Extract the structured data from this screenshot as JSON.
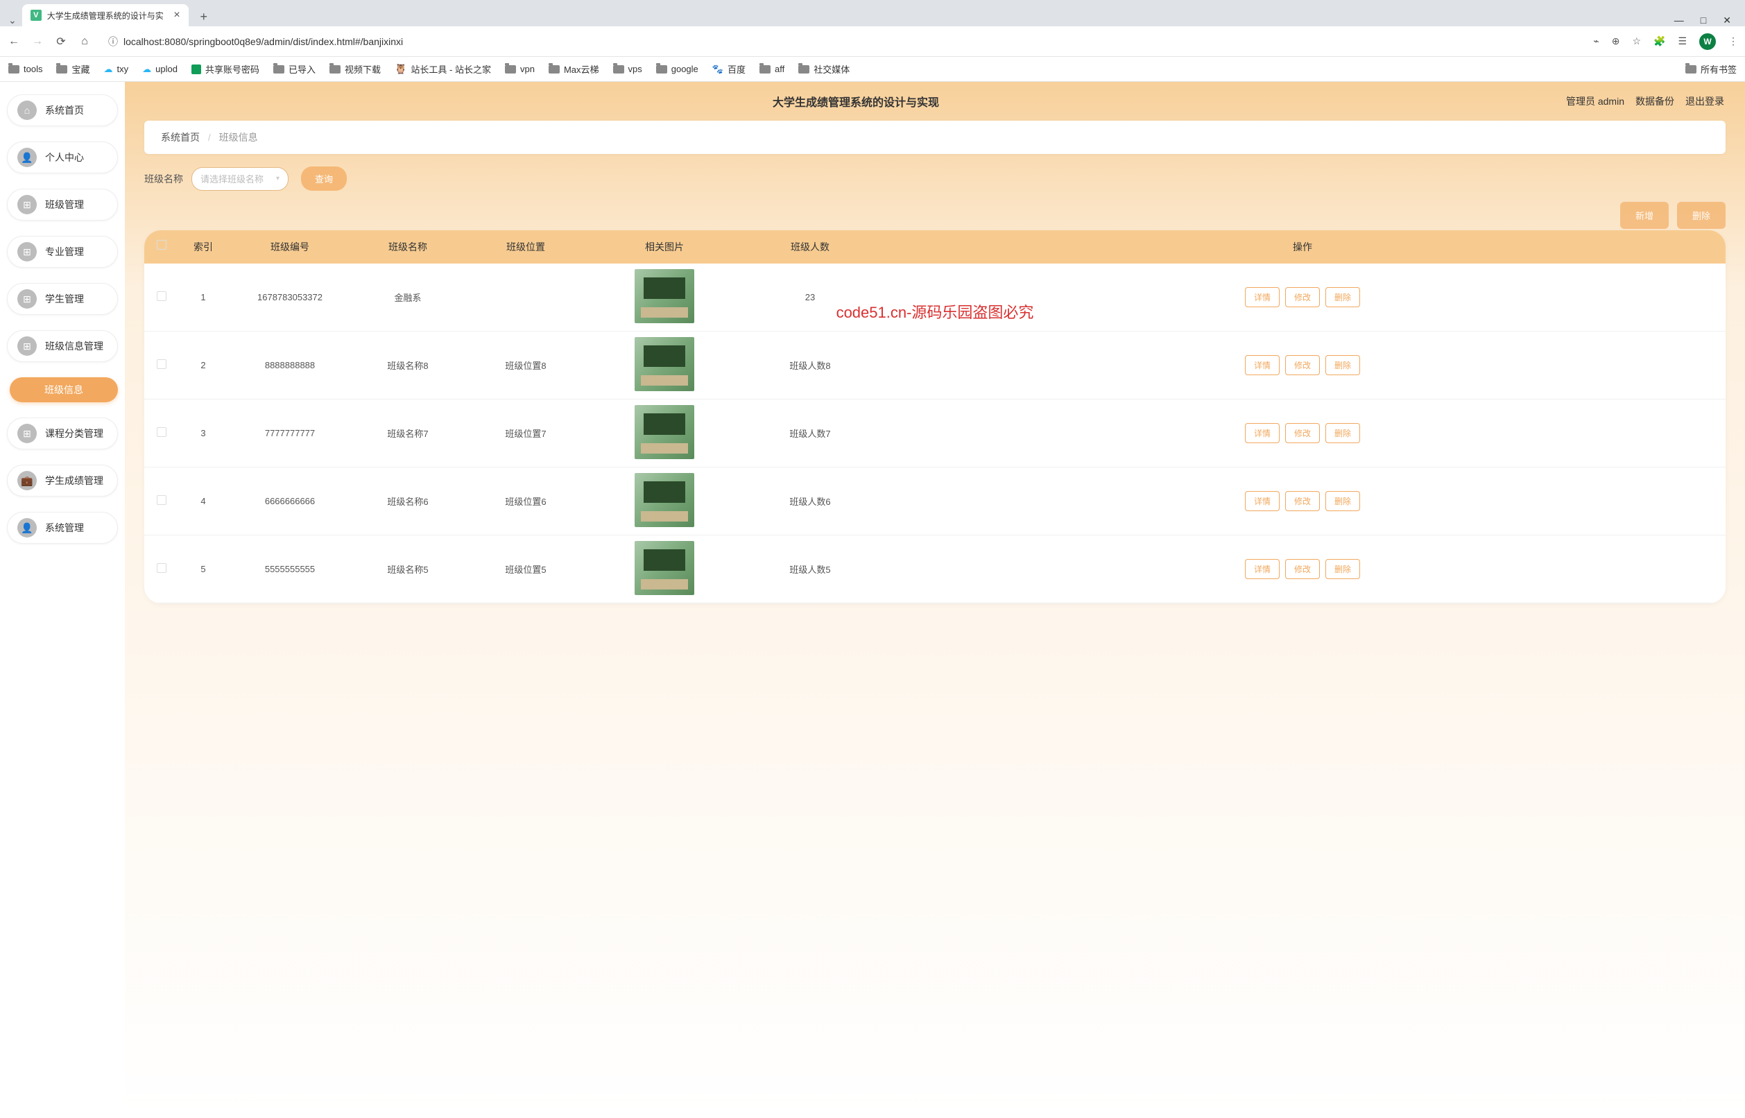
{
  "browser": {
    "tab_title": "大学生成绩管理系统的设计与实",
    "url": "localhost:8080/springboot0q8e9/admin/dist/index.html#/banjixinxi",
    "avatar_letter": "W",
    "favicon_letter": "V",
    "bookmarks": [
      {
        "label": "tools",
        "kind": "folder"
      },
      {
        "label": "宝藏",
        "kind": "folder"
      },
      {
        "label": "txy",
        "kind": "cloud"
      },
      {
        "label": "uplod",
        "kind": "cloud"
      },
      {
        "label": "共享账号密码",
        "kind": "sheet"
      },
      {
        "label": "已导入",
        "kind": "folder"
      },
      {
        "label": "视频下载",
        "kind": "folder"
      },
      {
        "label": "站长工具 - 站长之家",
        "kind": "owl"
      },
      {
        "label": "vpn",
        "kind": "folder"
      },
      {
        "label": "Max云梯",
        "kind": "folder"
      },
      {
        "label": "vps",
        "kind": "folder"
      },
      {
        "label": "google",
        "kind": "folder"
      },
      {
        "label": "百度",
        "kind": "paw"
      },
      {
        "label": "aff",
        "kind": "folder"
      },
      {
        "label": "社交媒体",
        "kind": "folder"
      }
    ],
    "bookmarks_right": {
      "label": "所有书签",
      "kind": "folder"
    }
  },
  "header": {
    "title": "大学生成绩管理系统的设计与实现",
    "user": "管理员 admin",
    "backup": "数据备份",
    "logout": "退出登录"
  },
  "sidebar": {
    "items": [
      {
        "label": "系统首页",
        "icon": "home"
      },
      {
        "label": "个人中心",
        "icon": "user"
      },
      {
        "label": "班级管理",
        "icon": "grid"
      },
      {
        "label": "专业管理",
        "icon": "grid"
      },
      {
        "label": "学生管理",
        "icon": "grid"
      },
      {
        "label": "班级信息管理",
        "icon": "grid"
      },
      {
        "label": "班级信息",
        "icon": "",
        "active": true
      },
      {
        "label": "课程分类管理",
        "icon": "grid"
      },
      {
        "label": "学生成绩管理",
        "icon": "briefcase"
      },
      {
        "label": "系统管理",
        "icon": "user"
      }
    ]
  },
  "breadcrumb": {
    "home": "系统首页",
    "current": "班级信息"
  },
  "search": {
    "label": "班级名称",
    "placeholder": "请选择班级名称",
    "query_btn": "查询"
  },
  "actions": {
    "add": "新增",
    "delete": "删除"
  },
  "table": {
    "columns": {
      "index": "索引",
      "code": "班级编号",
      "name": "班级名称",
      "location": "班级位置",
      "image": "相关图片",
      "count": "班级人数",
      "ops": "操作"
    },
    "row_ops": {
      "detail": "详情",
      "edit": "修改",
      "delete": "删除"
    },
    "rows": [
      {
        "idx": "1",
        "code": "1678783053372",
        "name": "金融系",
        "location": "",
        "count": "23"
      },
      {
        "idx": "2",
        "code": "8888888888",
        "name": "班级名称8",
        "location": "班级位置8",
        "count": "班级人数8"
      },
      {
        "idx": "3",
        "code": "7777777777",
        "name": "班级名称7",
        "location": "班级位置7",
        "count": "班级人数7"
      },
      {
        "idx": "4",
        "code": "6666666666",
        "name": "班级名称6",
        "location": "班级位置6",
        "count": "班级人数6"
      },
      {
        "idx": "5",
        "code": "5555555555",
        "name": "班级名称5",
        "location": "班级位置5",
        "count": "班级人数5"
      }
    ]
  },
  "watermark": "code51.cn-源码乐园盗图必究"
}
